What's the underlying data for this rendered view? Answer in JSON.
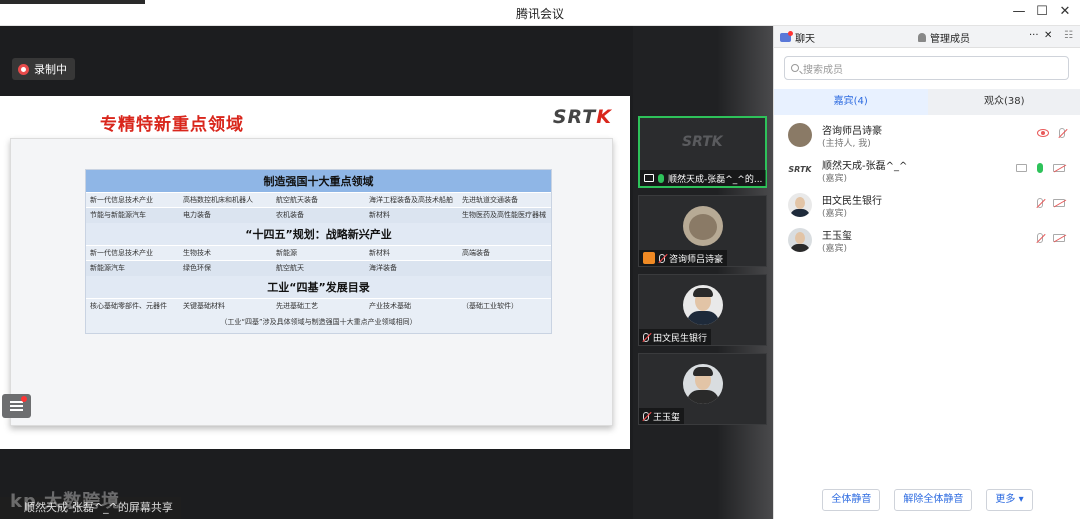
{
  "window": {
    "title": "腾讯会议",
    "minimize": "—",
    "maximize": "☐",
    "close": "✕"
  },
  "stage": {
    "recording_label": "录制中",
    "share_bar_text": "顺然天成-张磊^_^的屏幕共享",
    "watermark": "kp 大数跨境"
  },
  "slide": {
    "heading": "专精特新重点领域",
    "logo_main": "SRT",
    "logo_accent": "K",
    "section1": {
      "title": "制造强国十大重点领域",
      "rows": [
        [
          "新一代信息技术产业",
          "高档数控机床和机器人",
          "航空航天装备",
          "海洋工程装备及高技术船舶",
          "先进轨道交通装备"
        ],
        [
          "节能与新能源汽车",
          "电力装备",
          "农机装备",
          "新材料",
          "生物医药及高性能医疗器械"
        ]
      ]
    },
    "section2": {
      "title": "“十四五”规划：战略新兴产业",
      "rows": [
        [
          "新一代信息技术产业",
          "生物技术",
          "新能源",
          "新材料",
          "高端装备"
        ],
        [
          "新能源汽车",
          "绿色环保",
          "航空航天",
          "海洋装备",
          ""
        ]
      ]
    },
    "section3": {
      "title": "工业“四基”发展目录",
      "rows": [
        [
          "核心基础零部件、元器件",
          "关键基础材料",
          "先进基础工艺",
          "产业技术基础",
          "（基础工业软件）"
        ]
      ],
      "note": "（工业“四基”涉及具体领域与制造强国十大重点产业领域相同）"
    }
  },
  "tiles": [
    {
      "name": "顺然天成-张磊^_^的...",
      "logo": "SRTK"
    },
    {
      "name": "咨询师吕诗豪"
    },
    {
      "name": "田文民生银行"
    },
    {
      "name": "王玉玺"
    }
  ],
  "panel": {
    "tab_chat": "聊天",
    "tab_manage": "管理成员",
    "tab_more": "···",
    "tab_close": "✕",
    "tab_grid": "☷",
    "search_placeholder": "搜索成员",
    "seg_guests": "嘉宾(4)",
    "seg_audience": "观众(38)",
    "members": [
      {
        "name": "咨询师吕诗豪",
        "role": "(主持人, 我)"
      },
      {
        "name": "顺然天成-张磊^_^",
        "role": "(嘉宾)",
        "logo": "SRTK"
      },
      {
        "name": "田文民生银行",
        "role": "(嘉宾)"
      },
      {
        "name": "王玉玺",
        "role": "(嘉宾)"
      }
    ],
    "btn_mute_all": "全体静音",
    "btn_unmute_all": "解除全体静音",
    "btn_more": "更多 ▾"
  }
}
